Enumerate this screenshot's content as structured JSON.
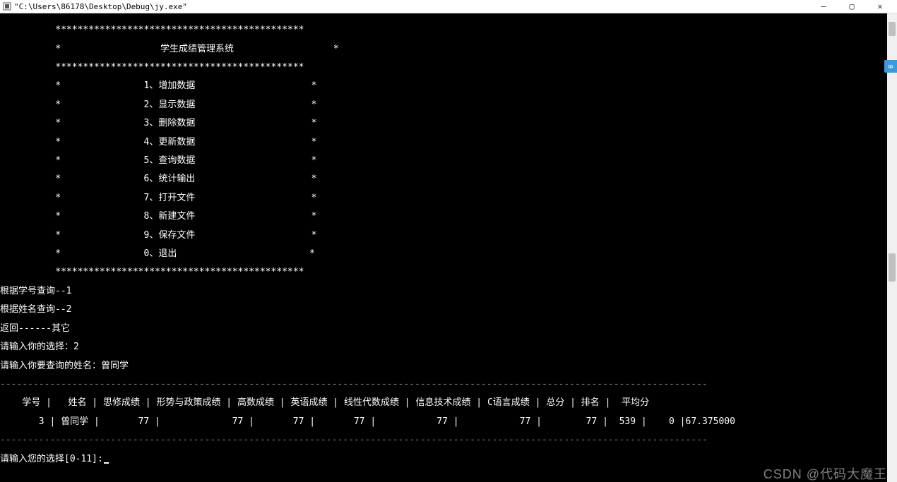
{
  "titlebar": {
    "title": "\"C:\\Users\\86178\\Desktop\\Debug\\jy.exe\"",
    "minimize": "—",
    "maximize": "▢",
    "close": "✕"
  },
  "menu": {
    "border_top": "          *********************************************",
    "title_row": "          *                  学生成绩管理系统                  *",
    "border_mid": "          *********************************************",
    "items": [
      "          *               1、增加数据                     *",
      "          *               2、显示数据                     *",
      "          *               3、删除数据                     *",
      "          *               4、更新数据                     *",
      "          *               5、查询数据                     *",
      "          *               6、统计输出                     *",
      "          *               7、打开文件                     *",
      "          *               8、新建文件                     *",
      "          *               9、保存文件                     *",
      "          *               0、退出                        *"
    ],
    "border_bot": "          *********************************************"
  },
  "query": {
    "by_id": "根据学号查询--1",
    "by_name": "根据姓名查询--2",
    "back": "返回------其它",
    "choice": "请输入你的选择：2",
    "name_prompt": "请输入你要查询的姓名：曾同学"
  },
  "table": {
    "sep": "--------------------------------------------------------------------------------------------------------------------------------",
    "headers": [
      "学号",
      "姓名",
      "思修成绩",
      "形势与政策成绩",
      "高数成绩",
      "英语成绩",
      "线性代数成绩",
      "信息技术成绩",
      "C语言成绩",
      "总分",
      "排名",
      "平均分"
    ],
    "row": {
      "id": "3",
      "name": "曾同学",
      "sixiu": "77",
      "xingshi": "77",
      "gaoshu": "77",
      "yingyu": "77",
      "xianxing": "77",
      "xinxi": "77",
      "cyuyan": "77",
      "zongfen": "539",
      "paiming": "0",
      "pingjun": "67.375000"
    }
  },
  "prompt": {
    "final": "请输入您的选择[0-11]:"
  },
  "watermark": "CSDN @代码大魔王",
  "widget": {
    "icon": "∞"
  }
}
